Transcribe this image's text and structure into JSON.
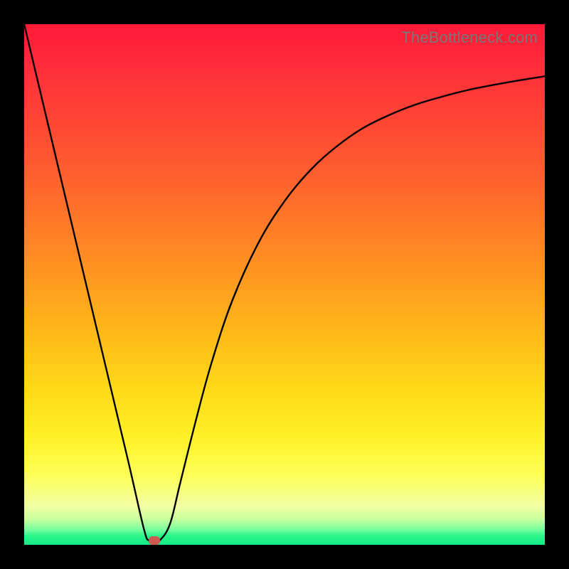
{
  "attribution": "TheBottleneck.com",
  "colors": {
    "frame": "#000000",
    "gradient_top": "#ff1938",
    "gradient_mid1": "#ff8a23",
    "gradient_mid2": "#fff22a",
    "gradient_bottom": "#17eb87",
    "curve": "#000000",
    "marker": "#cc5a52"
  },
  "chart_data": {
    "type": "line",
    "title": "",
    "xlabel": "",
    "ylabel": "",
    "xlim": [
      0,
      100
    ],
    "ylim": [
      0,
      100
    ],
    "grid": false,
    "series": [
      {
        "name": "bottleneck-curve",
        "x": [
          0,
          5,
          10,
          15,
          20,
          23,
          24,
          25,
          26,
          28,
          30,
          33,
          36,
          40,
          45,
          50,
          55,
          60,
          65,
          70,
          75,
          80,
          85,
          90,
          95,
          100
        ],
        "y": [
          100,
          79,
          58,
          37,
          16,
          3,
          0.5,
          0,
          0.5,
          4,
          12,
          24,
          35,
          47,
          58,
          66,
          72,
          76.5,
          80,
          82.5,
          84.5,
          86,
          87.3,
          88.3,
          89.2,
          90
        ]
      }
    ],
    "marker": {
      "x": 25,
      "y": 0
    },
    "notes": "y values are read off as height above bottom (0) toward top (100); curve dips to 0 near x≈25 then asymptotically rises toward ~90."
  }
}
